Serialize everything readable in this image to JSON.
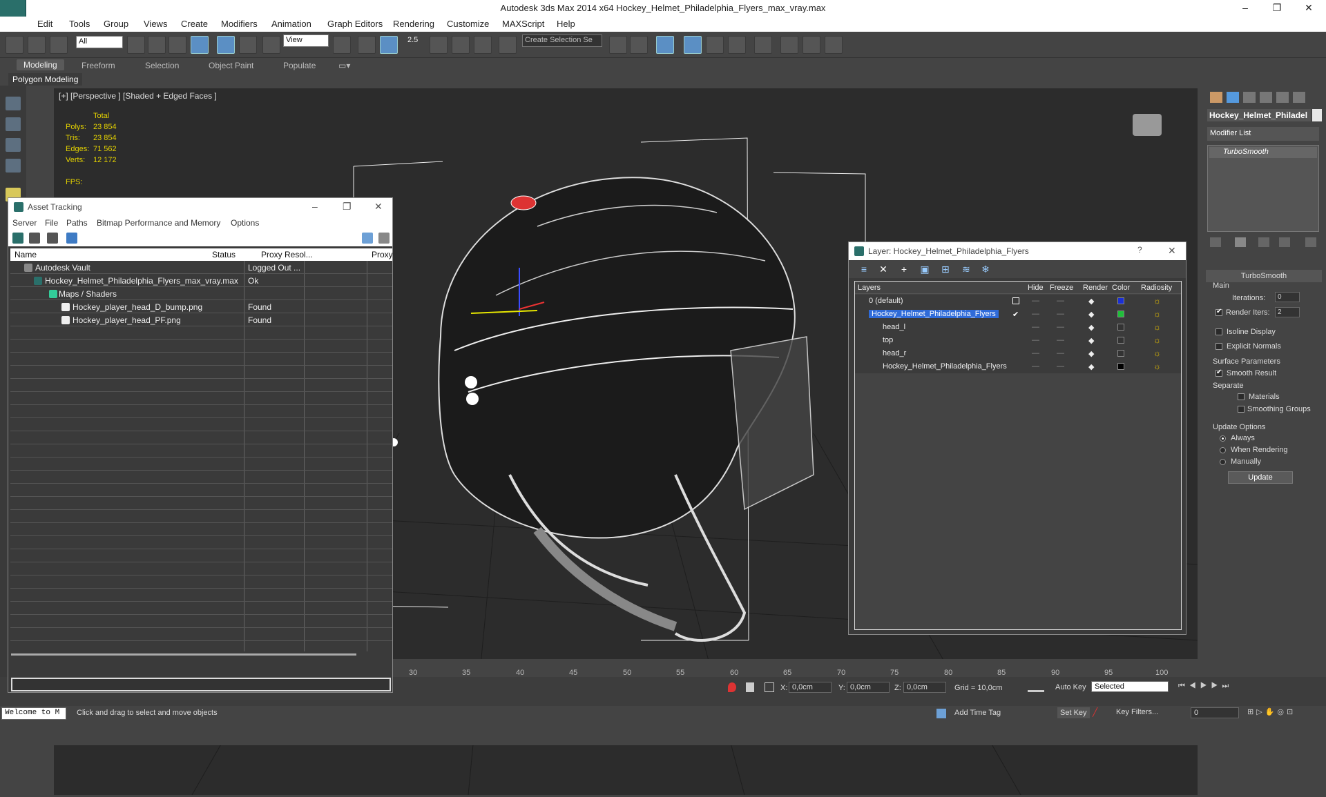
{
  "window": {
    "title": "Autodesk 3ds Max  2014 x64    Hockey_Helmet_Philadelphia_Flyers_max_vray.max",
    "controls": [
      "–",
      "❐",
      "✕"
    ]
  },
  "menu": [
    "Edit",
    "Tools",
    "Group",
    "Views",
    "Create",
    "Modifiers",
    "Animation",
    "Graph Editors",
    "Rendering",
    "Customize",
    "MAXScript",
    "Help"
  ],
  "toolbar": {
    "filter_value": "All",
    "refcoord_value": "View",
    "snap_label": "2.5",
    "selection_set_placeholder": "Create Selection Se"
  },
  "ribbon": {
    "tabs": [
      "Modeling",
      "Freeform",
      "Selection",
      "Object Paint",
      "Populate"
    ],
    "sub_label": "Polygon Modeling"
  },
  "viewport": {
    "label": "[+] [Perspective ] [Shaded + Edged Faces ]",
    "stats": {
      "total_label": "Total",
      "rows": [
        {
          "k": "Polys:",
          "v": "23 854"
        },
        {
          "k": "Tris:",
          "v": "23 854"
        },
        {
          "k": "Edges:",
          "v": "71 562"
        },
        {
          "k": "Verts:",
          "v": "12 172"
        }
      ],
      "fps_label": "FPS:"
    }
  },
  "asset_tracking": {
    "title": "Asset Tracking",
    "menu": [
      "Server",
      "File",
      "Paths",
      "Bitmap Performance and Memory",
      "Options"
    ],
    "columns": [
      "Name",
      "Status",
      "Proxy Resol...",
      "Proxy"
    ],
    "rows": [
      {
        "name": "Autodesk Vault",
        "status": "Logged Out ..."
      },
      {
        "name": "Hockey_Helmet_Philadelphia_Flyers_max_vray.max",
        "status": "Ok"
      },
      {
        "name": "Maps / Shaders",
        "status": ""
      },
      {
        "name": "Hockey_player_head_D_bump.png",
        "status": "Found"
      },
      {
        "name": "Hockey_player_head_PF.png",
        "status": "Found"
      }
    ]
  },
  "layer_window": {
    "title": "Layer: Hockey_Helmet_Philadelphia_Flyers",
    "help": "?",
    "close": "✕",
    "columns": [
      "Layers",
      "Hide",
      "Freeze",
      "Render",
      "Color",
      "Radiosity"
    ],
    "rows": [
      {
        "name": "0 (default)",
        "color": "#1a2fd6"
      },
      {
        "name": "Hockey_Helmet_Philadelphia_Flyers",
        "color": "#1fbf3a"
      },
      {
        "name": "head_l",
        "color": "#333333"
      },
      {
        "name": "top",
        "color": "#333333"
      },
      {
        "name": "head_r",
        "color": "#333333"
      },
      {
        "name": "Hockey_Helmet_Philadelphia_Flyers",
        "color": "#000000"
      }
    ]
  },
  "command_panel": {
    "object_name": "Hockey_Helmet_Philadel",
    "modifier_list": "Modifier List",
    "stack_item": "TurboSmooth",
    "rollout_title": "TurboSmooth",
    "main_label": "Main",
    "iterations_label": "Iterations:",
    "iterations_value": "0",
    "render_iters_label": "Render Iters:",
    "render_iters_value": "2",
    "isoline_label": "Isoline Display",
    "explicit_label": "Explicit Normals",
    "surface_label": "Surface Parameters",
    "smooth_label": "Smooth Result",
    "separate_label": "Separate",
    "materials_label": "Materials",
    "smoothing_groups_label": "Smoothing Groups",
    "update_options_label": "Update Options",
    "always_label": "Always",
    "when_rendering_label": "When Rendering",
    "manually_label": "Manually",
    "update_button": "Update"
  },
  "timeline": {
    "ticks": [
      "30",
      "35",
      "40",
      "45",
      "50",
      "55",
      "60",
      "65",
      "70",
      "75",
      "80",
      "85",
      "90",
      "95",
      "100"
    ]
  },
  "statusbar": {
    "welcome": "Welcome to M",
    "prompt": "Click and drag to select and move objects",
    "x_label": "X:",
    "x_value": "0,0cm",
    "y_label": "Y:",
    "y_value": "0,0cm",
    "z_label": "Z:",
    "z_value": "0,0cm",
    "grid": "Grid = 10,0cm",
    "add_time_tag": "Add Time Tag",
    "auto_key": "Auto Key",
    "set_key": "Set Key",
    "selected": "Selected",
    "key_filters": "Key Filters...",
    "frame_value": "0"
  }
}
